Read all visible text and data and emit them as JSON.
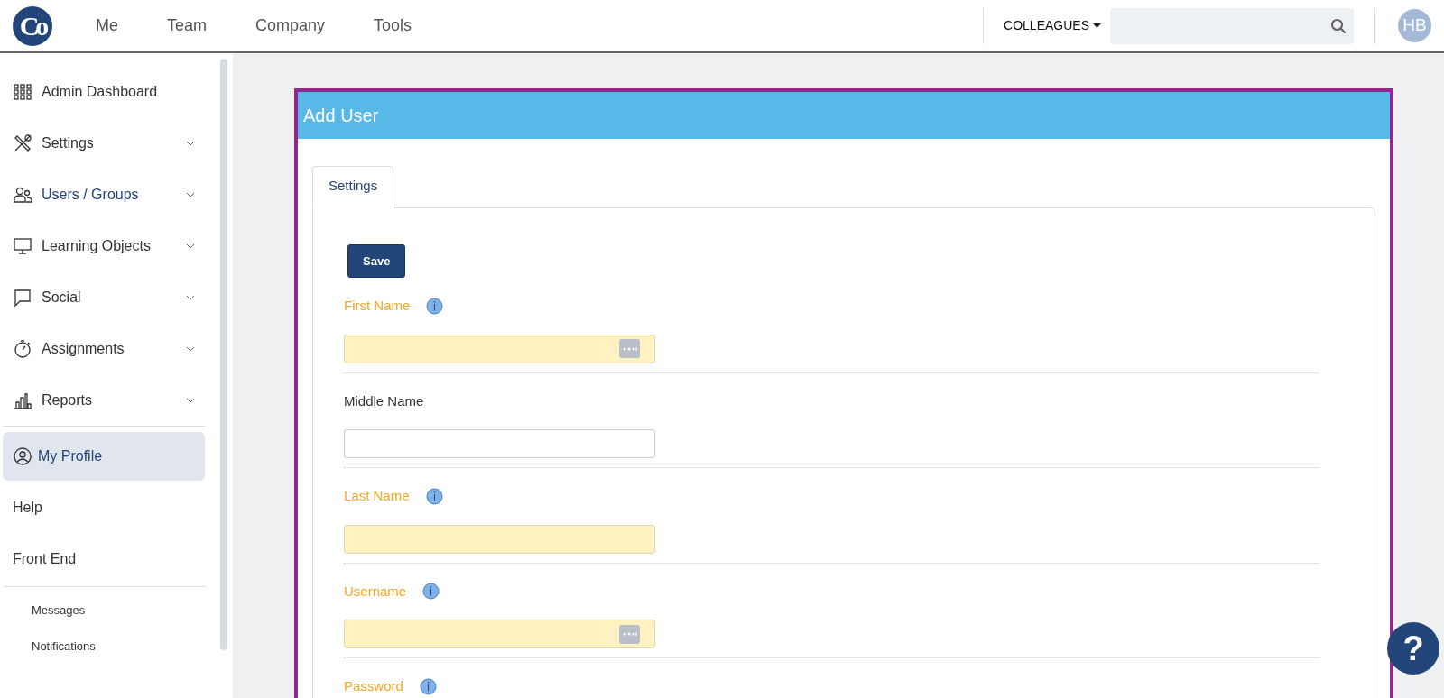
{
  "navbar": {
    "logo": "Co",
    "links": [
      {
        "label": "Me"
      },
      {
        "label": "Team"
      },
      {
        "label": "Company"
      },
      {
        "label": "Tools"
      }
    ],
    "scope_dropdown": "COLLEAGUES",
    "avatar": "HB"
  },
  "sidebar": {
    "menu": [
      {
        "label": "Admin Dashboard",
        "expandable": false,
        "highlighted": false
      },
      {
        "label": "Settings",
        "expandable": true,
        "highlighted": false
      },
      {
        "label": "Users / Groups",
        "expandable": true,
        "highlighted": true
      },
      {
        "label": "Learning Objects",
        "expandable": true,
        "highlighted": false
      },
      {
        "label": "Social",
        "expandable": true,
        "highlighted": false
      },
      {
        "label": "Assignments",
        "expandable": true,
        "highlighted": false
      },
      {
        "label": "Reports",
        "expandable": true,
        "highlighted": false
      }
    ],
    "account": [
      {
        "label": "My Profile",
        "kind": "profile",
        "selected": true
      },
      {
        "label": "Help",
        "kind": "link",
        "selected": false
      },
      {
        "label": "Front End",
        "kind": "link",
        "selected": false
      }
    ],
    "extras": [
      {
        "label": "Messages"
      },
      {
        "label": "Notifications"
      }
    ]
  },
  "panel": {
    "title": "Add User",
    "tabs": [
      {
        "label": "Settings",
        "selected": true
      }
    ],
    "save_button": "Save",
    "fields": [
      {
        "label": "First Name",
        "required": true,
        "info": true,
        "picker": true
      },
      {
        "label": "Middle Name",
        "required": false,
        "info": false,
        "picker": false
      },
      {
        "label": "Last Name",
        "required": true,
        "info": true,
        "picker": false
      },
      {
        "label": "Username",
        "required": true,
        "info": true,
        "picker": true
      },
      {
        "label": "Password",
        "required": true,
        "info": true
      }
    ]
  },
  "help_button": "?"
}
